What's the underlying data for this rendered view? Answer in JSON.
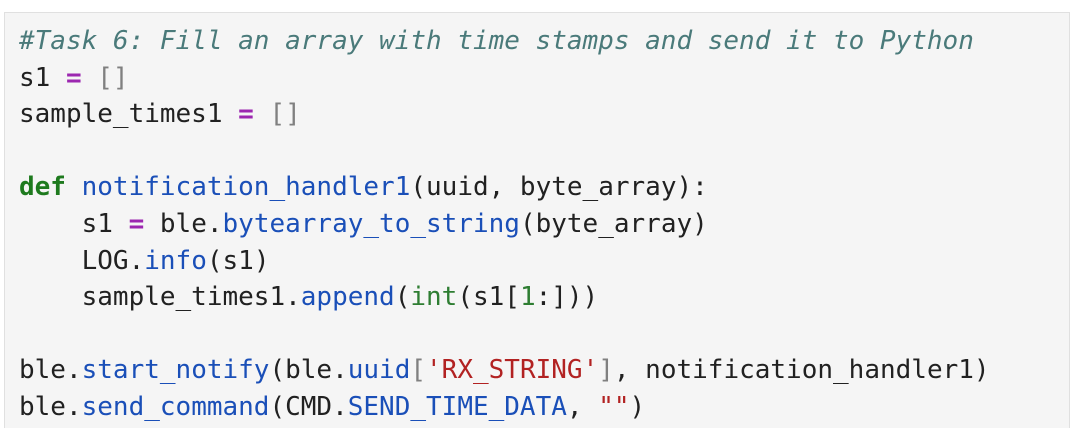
{
  "code_cell": {
    "lines": [
      [
        {
          "t": "#Task 6: Fill an array with time stamps and send it to Python",
          "c": "comment"
        }
      ],
      [
        {
          "t": "s1 ",
          "c": ""
        },
        {
          "t": "=",
          "c": "op"
        },
        {
          "t": " ",
          "c": ""
        },
        {
          "t": "[]",
          "c": "br"
        }
      ],
      [
        {
          "t": "sample_times1 ",
          "c": ""
        },
        {
          "t": "=",
          "c": "op"
        },
        {
          "t": " ",
          "c": ""
        },
        {
          "t": "[]",
          "c": "br"
        }
      ],
      [],
      [
        {
          "t": "def",
          "c": "kw"
        },
        {
          "t": " ",
          "c": ""
        },
        {
          "t": "notification_handler1",
          "c": "fn"
        },
        {
          "t": "(uuid, byte_array):",
          "c": ""
        }
      ],
      [
        {
          "t": "    s1 ",
          "c": ""
        },
        {
          "t": "=",
          "c": "op"
        },
        {
          "t": " ble.",
          "c": ""
        },
        {
          "t": "bytearray_to_string",
          "c": "attr"
        },
        {
          "t": "(byte_array)",
          "c": ""
        }
      ],
      [
        {
          "t": "    LOG.",
          "c": ""
        },
        {
          "t": "info",
          "c": "attr"
        },
        {
          "t": "(s1)",
          "c": ""
        }
      ],
      [
        {
          "t": "    sample_times1.",
          "c": ""
        },
        {
          "t": "append",
          "c": "attr"
        },
        {
          "t": "(",
          "c": ""
        },
        {
          "t": "int",
          "c": "builtin"
        },
        {
          "t": "(s1[",
          "c": ""
        },
        {
          "t": "1",
          "c": "num"
        },
        {
          "t": ":]))",
          "c": ""
        }
      ],
      [],
      [
        {
          "t": "ble.",
          "c": ""
        },
        {
          "t": "start_notify",
          "c": "attr"
        },
        {
          "t": "(ble.",
          "c": ""
        },
        {
          "t": "uuid",
          "c": "attr"
        },
        {
          "t": "[",
          "c": "br"
        },
        {
          "t": "'RX_STRING'",
          "c": "str"
        },
        {
          "t": "]",
          "c": "br"
        },
        {
          "t": ", notification_handler1)",
          "c": ""
        }
      ],
      [
        {
          "t": "ble.",
          "c": ""
        },
        {
          "t": "send_command",
          "c": "attr"
        },
        {
          "t": "(CMD.",
          "c": ""
        },
        {
          "t": "SEND_TIME_DATA",
          "c": "attr"
        },
        {
          "t": ", ",
          "c": ""
        },
        {
          "t": "\"\"",
          "c": "str"
        },
        {
          "t": ")",
          "c": ""
        }
      ]
    ]
  }
}
